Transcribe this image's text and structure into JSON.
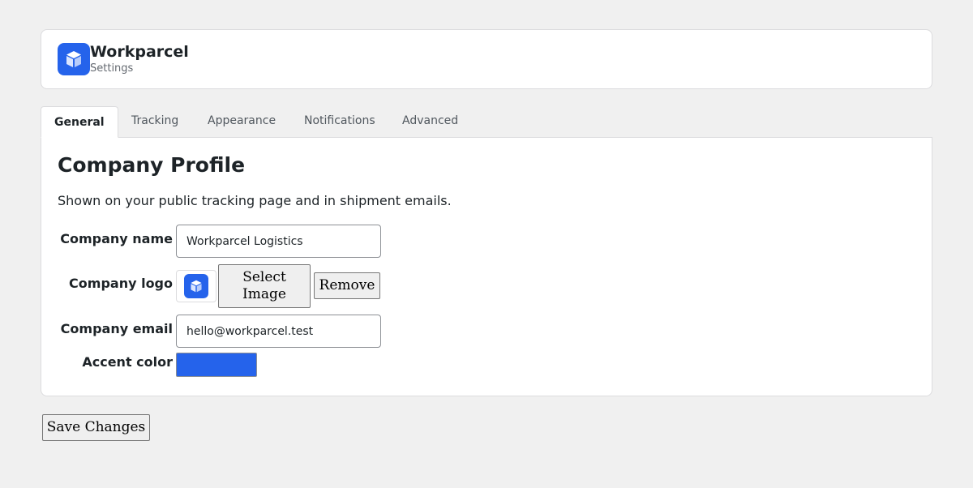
{
  "colors": {
    "accent": "#2563eb"
  },
  "header": {
    "logo_icon": "cube-icon",
    "title": "Workparcel",
    "subtitle": "Settings"
  },
  "tabs": [
    {
      "label": "General",
      "active": true
    },
    {
      "label": "Tracking",
      "active": false
    },
    {
      "label": "Appearance",
      "active": false
    },
    {
      "label": "Notifications",
      "active": false
    },
    {
      "label": "Advanced",
      "active": false
    }
  ],
  "panel": {
    "title": "Company Profile",
    "description": "Shown on your public tracking page and in shipment emails."
  },
  "form": {
    "company_name": {
      "label": "Company name",
      "value": "Workparcel Logistics"
    },
    "company_logo": {
      "label": "Company logo",
      "select_label": "Select Image",
      "remove_label": "Remove",
      "icon": "cube-icon"
    },
    "company_email": {
      "label": "Company email",
      "value": "hello@workparcel.test"
    },
    "accent_color": {
      "label": "Accent color",
      "value": "#2563eb"
    }
  },
  "actions": {
    "save_label": "Save Changes"
  }
}
